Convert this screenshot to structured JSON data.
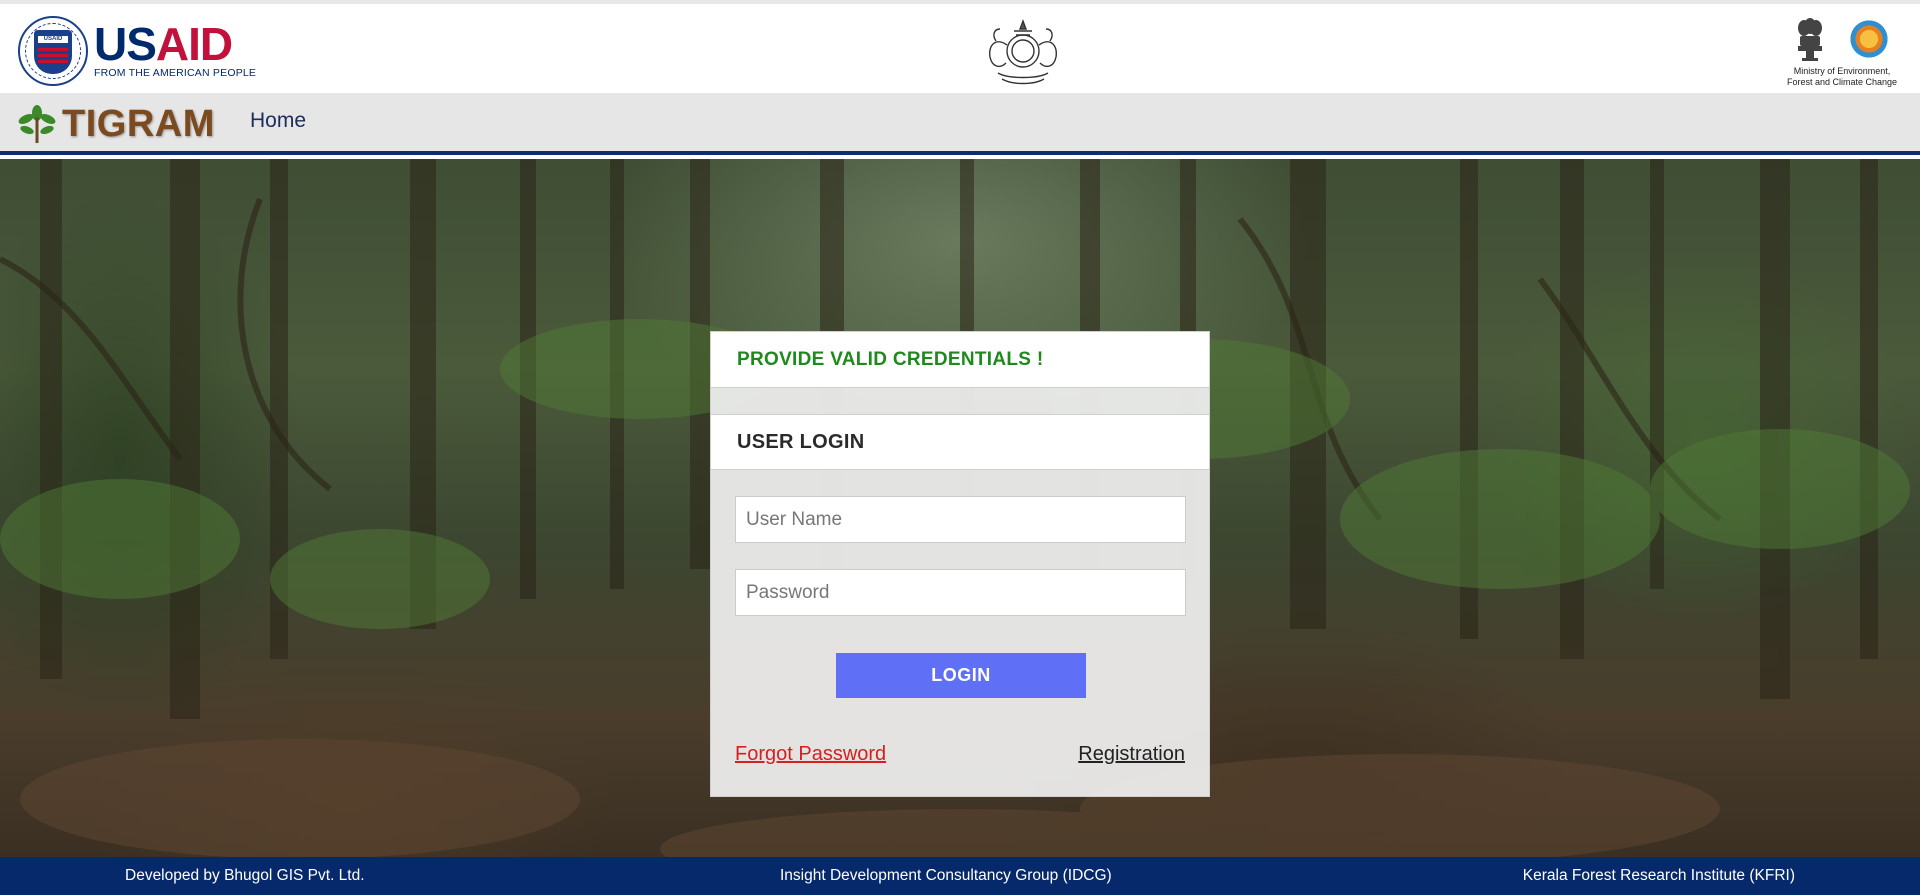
{
  "header": {
    "usaid": {
      "word_us": "US",
      "word_aid": "AID",
      "tagline": "FROM THE AMERICAN PEOPLE",
      "seal_text": "USAID"
    },
    "ministry": {
      "line1": "Ministry of Environment,",
      "line2": "Forest and Climate Change"
    }
  },
  "nav": {
    "brand": "TIGRAM",
    "home_label": "Home"
  },
  "login": {
    "message": "PROVIDE VALID CREDENTIALS !",
    "title": "USER LOGIN",
    "username_placeholder": "User Name",
    "username_value": "",
    "password_placeholder": "Password",
    "password_value": "",
    "login_label": "LOGIN",
    "forgot_label": "Forgot Password",
    "register_label": "Registration"
  },
  "footer": {
    "left": "Developed by Bhugol GIS Pvt. Ltd.",
    "center": "Insight Development Consultancy Group (IDCG)",
    "right": "Kerala Forest Research Institute (KFRI)"
  },
  "colors": {
    "usaid_blue": "#002a6c",
    "usaid_red": "#c2113a",
    "nav_bg": "#e6e6e6",
    "nav_border": "#112d6e",
    "brand_brown": "#7b4a1f",
    "success_green": "#1e8a1e",
    "button_blue": "#6070f6",
    "link_red": "#d42020",
    "footer_bg": "#05296a"
  },
  "icons": [
    "usaid-seal-icon",
    "kerala-emblem-icon",
    "ashoka-emblem-icon",
    "moefcc-logo-icon",
    "tree-icon"
  ]
}
